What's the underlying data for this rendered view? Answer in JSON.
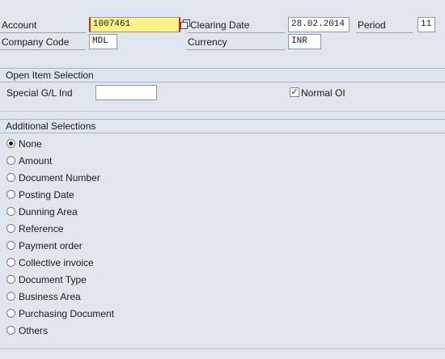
{
  "header": {
    "account_label": "Account",
    "account_value": "1007461",
    "company_code_label": "Company Code",
    "company_code_value": "MDL",
    "clearing_date_label": "Clearing Date",
    "clearing_date_value": "28.02.2014",
    "period_label": "Period",
    "period_value": "11",
    "currency_label": "Currency",
    "currency_value": "INR"
  },
  "open_item_selection": {
    "title": "Open Item Selection",
    "special_gl_label": "Special G/L Ind",
    "special_gl_value": "",
    "normal_oi_label": "Normal OI",
    "normal_oi_checked": true,
    "check_glyph": "✓"
  },
  "additional_selections": {
    "title": "Additional Selections",
    "selected": "None",
    "options": [
      "None",
      "Amount",
      "Document Number",
      "Posting Date",
      "Dunning Area",
      "Reference",
      "Payment order",
      "Collective invoice",
      "Document Type",
      "Business Area",
      "Purchasing Document",
      "Others"
    ]
  },
  "colors": {
    "background": "#dfe6ee",
    "required_field": "#fbf08a",
    "section_header": "#dbe6f1"
  },
  "icons": {
    "account_match": "multiple-selection-icon"
  }
}
